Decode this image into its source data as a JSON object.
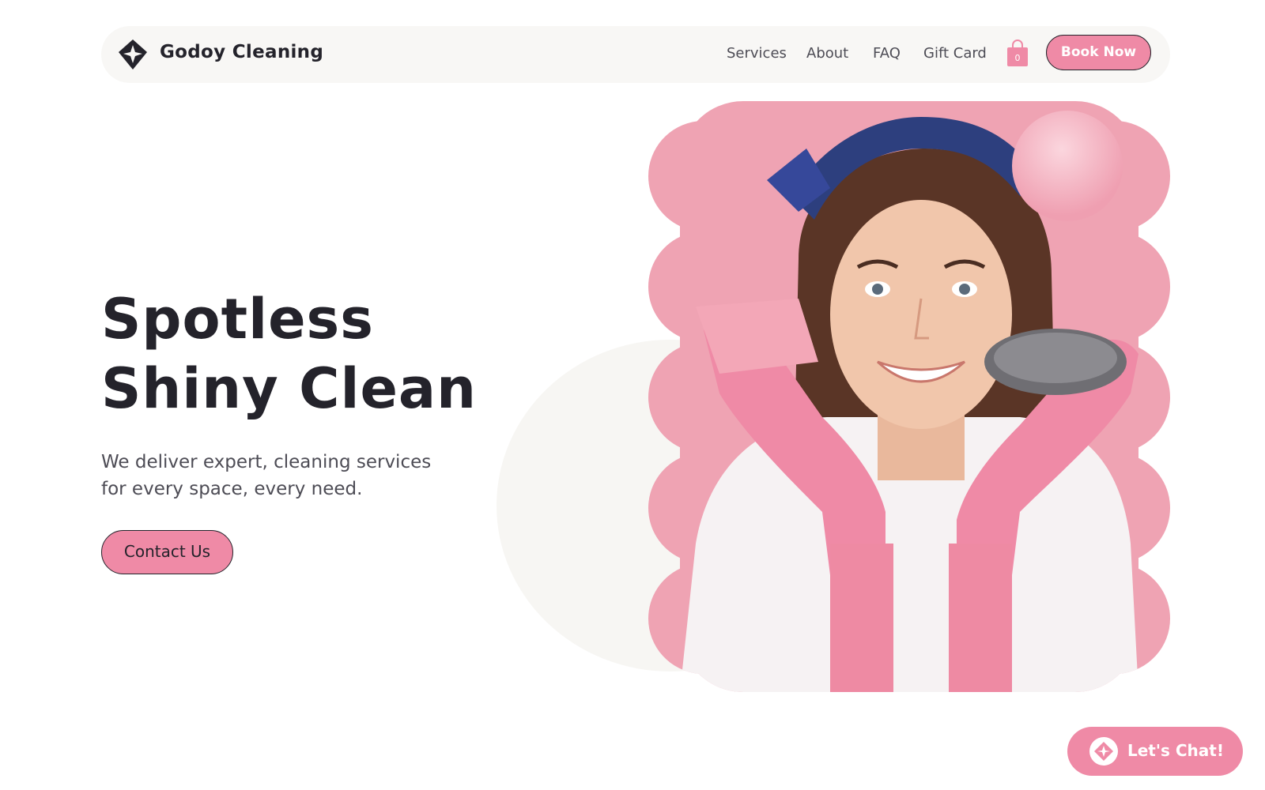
{
  "header": {
    "brand": "Godoy Cleaning",
    "logo_icon": "diamond-star-logo-icon",
    "nav": [
      "Services",
      "About",
      "FAQ",
      "Gift Card"
    ],
    "cart_icon": "shopping-bag-icon",
    "cart_count": "0",
    "book_label": "Book Now"
  },
  "hero": {
    "title_line1": "Spotless",
    "title_line2": "Shiny Clean",
    "subtitle_line1": "We deliver expert, cleaning services",
    "subtitle_line2": "for every space, every need.",
    "contact_label": "Contact Us",
    "image_subject": "smiling woman with pink gloves, sponge and scrubber"
  },
  "chat": {
    "label": "Let's Chat!",
    "icon": "chat-logo-icon"
  },
  "colors": {
    "accent_pink": "#ef8aa6",
    "image_bg_pink": "#efa3b3",
    "dark_text": "#24232b",
    "header_bg": "#f8f7f5"
  }
}
